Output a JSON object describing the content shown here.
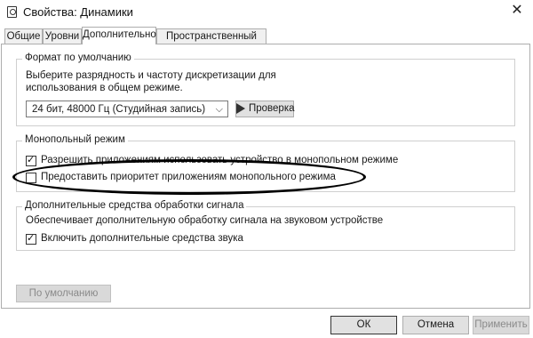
{
  "window": {
    "title": "Свойства: Динамики"
  },
  "tabs": [
    "Общие",
    "Уровни",
    "Дополнительно",
    "Пространственный звук"
  ],
  "format_group": {
    "title": "Формат по умолчанию",
    "description_line1": "Выберите разрядность и частоту дискретизации для",
    "description_line2": "использования в общем режиме.",
    "selected_format": "24 бит, 48000 Гц (Студийная запись)",
    "test_button": "Проверка"
  },
  "exclusive_group": {
    "title": "Монопольный режим",
    "allow_exclusive_label": "Разрешить приложениям использовать устройство в монопольном режиме",
    "allow_exclusive_checked": true,
    "priority_label": "Предоставить приоритет приложениям монопольного режима",
    "priority_checked": false
  },
  "enhancements_group": {
    "title": "Дополнительные средства обработки сигнала",
    "description": "Обеспечивает дополнительную обработку сигнала на звуковом устройстве",
    "enable_label": "Включить дополнительные средства звука",
    "enable_checked": true
  },
  "buttons": {
    "restore_defaults": "По умолчанию",
    "ok": "ОК",
    "cancel": "Отмена",
    "apply": "Применить"
  }
}
